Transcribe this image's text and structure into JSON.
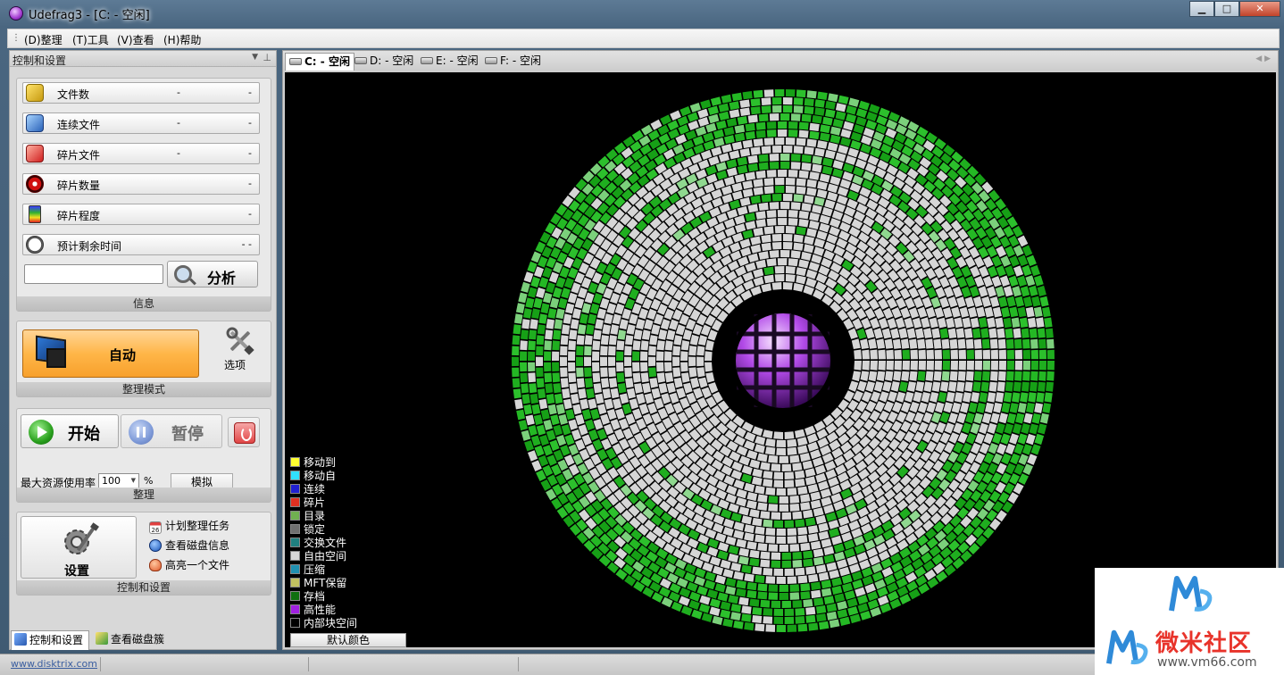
{
  "window": {
    "title": "Udefrag3 - [C: - 空闲]",
    "controls": {
      "minimize": "▁",
      "maximize": "□",
      "close": "✕"
    }
  },
  "menu": [
    "(D)整理",
    "(T)工具",
    "(V)查看",
    "(H)帮助"
  ],
  "left_panel": {
    "header": "控制和设置",
    "info": {
      "stats": [
        {
          "label": "文件数",
          "mid": "-",
          "value": "-",
          "icon": "files-icon",
          "color": "#d8b11a"
        },
        {
          "label": "连续文件",
          "mid": "-",
          "value": "-",
          "icon": "contiguous-files-icon",
          "color": "#3a7fd8"
        },
        {
          "label": "碎片文件",
          "mid": "-",
          "value": "-",
          "icon": "fragmented-files-icon",
          "color": "#d83a3a"
        },
        {
          "label": "碎片数量",
          "mid": "",
          "value": "-",
          "icon": "fragment-count-icon",
          "color": "#c81818"
        },
        {
          "label": "碎片程度",
          "mid": "",
          "value": "-",
          "icon": "fragmentation-level-icon",
          "color": "#2a8a2a"
        },
        {
          "label": "预计剩余时间",
          "mid": "",
          "value": "- -",
          "icon": "stopwatch-icon",
          "color": "#777777"
        }
      ],
      "search_value": "",
      "analyze_label": "分析",
      "caption": "信息"
    },
    "mode": {
      "auto_label": "自动",
      "options_label": "选项",
      "caption": "整理模式"
    },
    "defrag": {
      "start_label": "开始",
      "pause_label": "暂停",
      "resource_label": "最大资源使用率",
      "resource_value": "100",
      "resource_unit": "%",
      "simulate_label": "模拟",
      "caption": "整理"
    },
    "control": {
      "settings_label": "设置",
      "links": [
        "计划整理任务",
        "查看磁盘信息",
        "高亮一个文件"
      ],
      "calendar_day": "26",
      "caption": "控制和设置"
    },
    "bottom_tabs": [
      "控制和设置",
      "查看磁盘簇"
    ]
  },
  "drive_tabs": [
    "C: - 空闲",
    "D: - 空闲",
    "E: - 空闲",
    "F: - 空闲"
  ],
  "legend": [
    {
      "label": "移动到",
      "color": "#ffff30"
    },
    {
      "label": "移动自",
      "color": "#30e0ff"
    },
    {
      "label": "连续",
      "color": "#2020d0"
    },
    {
      "label": "碎片",
      "color": "#e03020"
    },
    {
      "label": "目录",
      "color": "#70b050"
    },
    {
      "label": "锁定",
      "color": "#707070"
    },
    {
      "label": "交换文件",
      "color": "#208080"
    },
    {
      "label": "自由空间",
      "color": "#d8d8d8"
    },
    {
      "label": "压缩",
      "color": "#2090b0"
    },
    {
      "label": "MFT保留",
      "color": "#c0c060"
    },
    {
      "label": "存档",
      "color": "#107010"
    },
    {
      "label": "高性能",
      "color": "#a020e0"
    },
    {
      "label": "内部块空间",
      "color": "#000000"
    }
  ],
  "default_color_label": "默认颜色",
  "status": {
    "url": "www.disktrix.com"
  },
  "watermark": {
    "brand": "微米社区",
    "url": "www.vm66.com"
  }
}
